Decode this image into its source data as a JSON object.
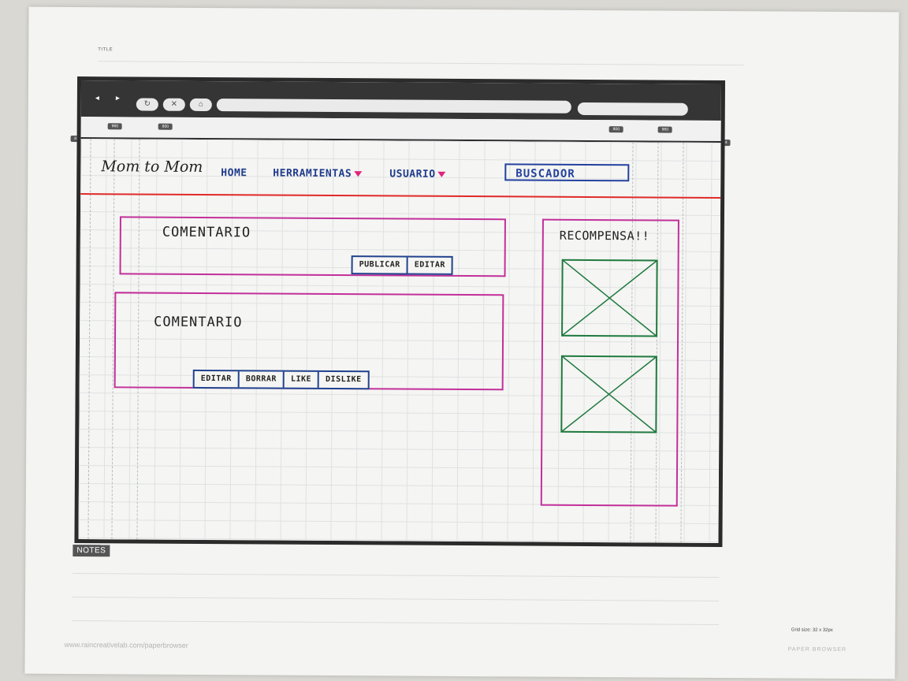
{
  "sheet": {
    "title_label": "TITLE",
    "notes_label": "NOTES",
    "footer_url": "www.raincreativelab.com/paperbrowser",
    "grid_size": "Grid size: 32 x 32px",
    "brand": "PAPER BROWSER"
  },
  "browser": {
    "back_glyph": "◂",
    "forward_glyph": "▸",
    "reload_glyph": "↻",
    "stop_glyph": "✕",
    "home_glyph": "⌂",
    "ruler_labels": [
      "1024",
      "960",
      "800",
      "800",
      "960",
      "1024"
    ]
  },
  "app": {
    "logo": "Mom to Mom",
    "nav": [
      {
        "label": "HOME"
      },
      {
        "label": "HERRAMIENTAS"
      },
      {
        "label": "USUARIO"
      }
    ],
    "search_label": "BUSCADOR"
  },
  "comments": [
    {
      "label": "COMENTARIO",
      "buttons": [
        "PUBLICAR",
        "EDITAR"
      ]
    },
    {
      "label": "COMENTARIO",
      "buttons": [
        "EDITAR",
        "BORRAR",
        "LIKE",
        "DISLIKE"
      ]
    }
  ],
  "reward": {
    "title": "RECOMPENSA!!"
  },
  "colors": {
    "nav_blue": "#1f3b8c",
    "box_magenta": "#c2309a",
    "image_green": "#1f7a3f",
    "divider_red": "#e12a2a"
  }
}
